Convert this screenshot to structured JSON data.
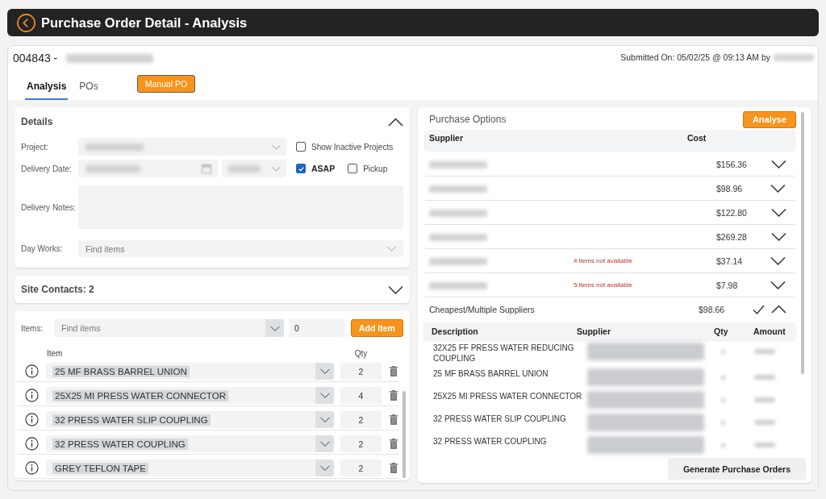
{
  "header": {
    "title": "Purchase Order Detail - Analysis"
  },
  "order": {
    "number": "004843 -",
    "submitted": "Submitted On: 05/02/25 @ 09:13 AM by"
  },
  "tabs": [
    {
      "label": "Analysis",
      "selected": true
    },
    {
      "label": "POs",
      "selected": false
    }
  ],
  "manual_po_button": "Manual PO",
  "details": {
    "title": "Details",
    "expanded": true,
    "project": {
      "label": "Project:"
    },
    "show_inactive_projects": {
      "label": "Show Inactive Projects",
      "checked": false
    },
    "delivery_date": {
      "label": "Delivery Date:"
    },
    "asap": {
      "label": "ASAP",
      "checked": true
    },
    "pickup": {
      "label": "Pickup",
      "checked": false
    },
    "delivery_notes": {
      "label": "Delivery Notes:"
    },
    "day_works": {
      "label": "Day Works:",
      "placeholder": "Find items"
    }
  },
  "site_contacts": {
    "title": "Site Contacts: 2",
    "expanded": false
  },
  "items": {
    "label": "Items:",
    "placeholder": "Find items",
    "quantity": "0",
    "add_button": "Add Item",
    "columns": [
      "Item",
      "Qty"
    ],
    "rows": [
      {
        "name": "25 MF BRASS BARREL UNION",
        "qty": "2"
      },
      {
        "name": "25X25 MI PRESS WATER CONNECTOR",
        "qty": "4"
      },
      {
        "name": "32 PRESS WATER SLIP COUPLING",
        "qty": "2"
      },
      {
        "name": "32 PRESS WATER COUPLING",
        "qty": "2"
      },
      {
        "name": "GREY TEFLON TAPE",
        "qty": "2"
      }
    ]
  },
  "purchase_options": {
    "title": "Purchase Options",
    "analyse_button": "Analyse",
    "columns": [
      "Supplier",
      "Cost"
    ],
    "suppliers": [
      {
        "cost": "$156.36",
        "expanded": false
      },
      {
        "cost": "$98.96",
        "expanded": false
      },
      {
        "cost": "$122.80",
        "expanded": false
      },
      {
        "cost": "$269.28",
        "expanded": false
      },
      {
        "note": "4 items not available",
        "cost": "$37.14",
        "expanded": false
      },
      {
        "note": "5 items not available",
        "cost": "$7.98",
        "expanded": false
      }
    ],
    "cheapest": {
      "label": "Cheapest/Multiple Suppliers",
      "cost": "$98.66",
      "selected": true,
      "expanded": true
    },
    "breakdown": {
      "columns": [
        "Description",
        "Supplier",
        "Qty",
        "Amount"
      ],
      "rows": [
        {
          "description": "32X25 FF PRESS WATER REDUCING COUPLING"
        },
        {
          "description": "25 MF BRASS BARREL UNION"
        },
        {
          "description": "25X25 MI PRESS WATER CONNECTOR"
        },
        {
          "description": "32 PRESS WATER SLIP COUPLING"
        },
        {
          "description": "32 PRESS WATER COUPLING"
        }
      ]
    },
    "generate_button": "Generate Purchase Orders"
  }
}
